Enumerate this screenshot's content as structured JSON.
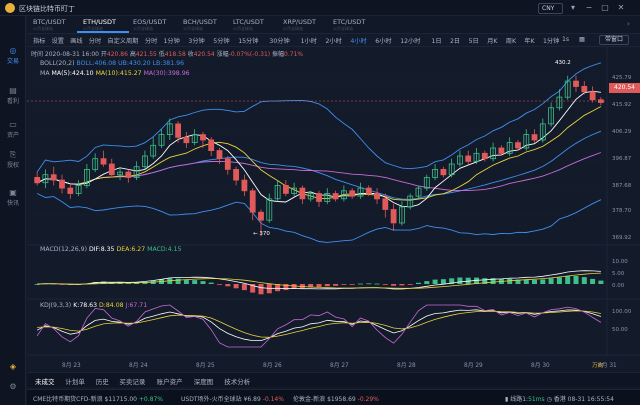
{
  "app": {
    "title": "区块链比特币盯丁",
    "currency": "CNY"
  },
  "sidebar": [
    {
      "label": "交易",
      "icon": "trade-icon",
      "active": true
    },
    {
      "label": "看利",
      "icon": "profit-icon"
    },
    {
      "label": "资产",
      "icon": "asset-icon"
    },
    {
      "label": "授权",
      "icon": "auth-icon"
    },
    {
      "label": "快讯",
      "icon": "news-icon"
    }
  ],
  "pairs": [
    {
      "name": "BTC/USDT",
      "sub": "火币全球站"
    },
    {
      "name": "ETH/USDT",
      "sub": "火币全球站",
      "active": true
    },
    {
      "name": "EOS/USDT",
      "sub": "火币全球站"
    },
    {
      "name": "BCH/USDT",
      "sub": "火币全球站"
    },
    {
      "name": "LTC/USDT",
      "sub": "火币全球站"
    },
    {
      "name": "XRP/USDT",
      "sub": "火币全球站"
    },
    {
      "name": "ETC/USDT",
      "sub": "火币全球站"
    }
  ],
  "toolbar": {
    "items": [
      "指标",
      "设置",
      "画线",
      "分时",
      "自定义周期",
      "分时",
      "1分钟",
      "3分钟",
      "5分钟",
      "15分钟",
      "30分钟",
      "1小时",
      "2小时",
      "4小时",
      "6小时",
      "12小时",
      "1日",
      "2日",
      "5日",
      "月K",
      "周K",
      "年K",
      "1分钟"
    ],
    "active": "4小时",
    "interval": "1s",
    "draw": "带窗口"
  },
  "info": {
    "time": "时间 2020-08-31 16:00",
    "open_l": "开",
    "open": "420.86",
    "high_l": "高",
    "high": "421.55",
    "low_l": "低",
    "low": "418.58",
    "close_l": "收",
    "close": "420.54",
    "chg_l": "涨幅",
    "chg": "-0.07%(-0.31)",
    "amp_l": "振幅",
    "amp": "0.71%"
  },
  "indicators": {
    "boll_label": "BOLL(20,2)",
    "boll": "BOLL:406.08",
    "ub": "UB:430.20",
    "lb": "LB:381.96",
    "ma_label": "MA",
    "ma5": "MA(5):424.10",
    "ma10": "MA(10):415.27",
    "ma30": "MA(30):398.96",
    "macd_label": "MACD(12,26,9)",
    "dif": "DIF:8.35",
    "dea": "DEA:6.27",
    "macd": "MACD:4.15",
    "kdj_label": "KDJ(9,3,3)",
    "k": "K:78.63",
    "d": "D:84.08",
    "j": "J:67.71"
  },
  "annotations": {
    "high": "430.2",
    "low": "370"
  },
  "y_ticks": [
    "425.79",
    "415.92",
    "406.29",
    "396.87",
    "387.68",
    "378.70",
    "369.92"
  ],
  "macd_ticks": [
    "10.00",
    "5.00",
    "0.00"
  ],
  "kdj_ticks": [
    "100.00",
    "50.00"
  ],
  "current_price": "420.54",
  "x_ticks": [
    "8月 23",
    "8月 24",
    "8月 25",
    "8月 26",
    "8月 27",
    "8月 28",
    "8月 29",
    "8月 30",
    "8月 31"
  ],
  "x_extra": "万向",
  "bottom_tabs": [
    "未成交",
    "计划单",
    "历史",
    "买卖记录",
    "账户资产",
    "深度图",
    "技术分析"
  ],
  "status": [
    {
      "label": "CME比特币期货CFD-新浪",
      "price": "$11715.00",
      "chg": "+0.87%",
      "dir": "up"
    },
    {
      "label": "USDT场外-火币全球站",
      "price": "¥6.89",
      "chg": "-0.14%",
      "dir": "down"
    },
    {
      "label": "伦敦金-新浪",
      "price": "$1958.69",
      "chg": "-0.29%",
      "dir": "down"
    }
  ],
  "status_right": {
    "line": "线路1:",
    "ms": "51ms",
    "tz": "香港 08-31 16:55:54"
  },
  "chart_data": {
    "type": "candlestick",
    "x": [
      "8月 23",
      "8月 24",
      "8月 25",
      "8月 26",
      "8月 27",
      "8月 28",
      "8月 29",
      "8月 30",
      "8月 31"
    ],
    "candles": [
      [
        392,
        390,
        394,
        389
      ],
      [
        390,
        393,
        395,
        388
      ],
      [
        393,
        391,
        396,
        389
      ],
      [
        391,
        388,
        393,
        386
      ],
      [
        388,
        386,
        390,
        384
      ],
      [
        386,
        389,
        391,
        385
      ],
      [
        389,
        395,
        397,
        388
      ],
      [
        395,
        399,
        401,
        394
      ],
      [
        399,
        397,
        402,
        396
      ],
      [
        397,
        393,
        399,
        392
      ],
      [
        393,
        394,
        396,
        391
      ],
      [
        394,
        392,
        395,
        390
      ],
      [
        392,
        396,
        398,
        391
      ],
      [
        396,
        400,
        402,
        395
      ],
      [
        400,
        404,
        407,
        399
      ],
      [
        404,
        408,
        410,
        403
      ],
      [
        408,
        412,
        414,
        406
      ],
      [
        412,
        407,
        413,
        405
      ],
      [
        407,
        405,
        409,
        403
      ],
      [
        405,
        408,
        410,
        404
      ],
      [
        408,
        406,
        409,
        403
      ],
      [
        406,
        402,
        407,
        400
      ],
      [
        402,
        399,
        403,
        397
      ],
      [
        399,
        395,
        400,
        393
      ],
      [
        395,
        391,
        396,
        389
      ],
      [
        391,
        387,
        393,
        385
      ],
      [
        387,
        379,
        388,
        376
      ],
      [
        379,
        376,
        380,
        370
      ],
      [
        376,
        384,
        386,
        375
      ],
      [
        384,
        389,
        391,
        383
      ],
      [
        389,
        386,
        391,
        385
      ],
      [
        386,
        388,
        390,
        385
      ],
      [
        388,
        384,
        389,
        382
      ],
      [
        384,
        386,
        387,
        383
      ],
      [
        386,
        383,
        387,
        381
      ],
      [
        383,
        386,
        388,
        382
      ],
      [
        386,
        384,
        387,
        383
      ],
      [
        384,
        387,
        389,
        383
      ],
      [
        387,
        385,
        388,
        384
      ],
      [
        385,
        388,
        390,
        384
      ],
      [
        388,
        386,
        389,
        385
      ],
      [
        386,
        384,
        388,
        382
      ],
      [
        384,
        380,
        386,
        377
      ],
      [
        380,
        375,
        382,
        372
      ],
      [
        375,
        381,
        383,
        374
      ],
      [
        381,
        385,
        386,
        380
      ],
      [
        385,
        388,
        389,
        384
      ],
      [
        388,
        392,
        393,
        387
      ],
      [
        392,
        395,
        397,
        391
      ],
      [
        395,
        393,
        396,
        392
      ],
      [
        393,
        397,
        399,
        392
      ],
      [
        397,
        400,
        402,
        396
      ],
      [
        400,
        398,
        402,
        397
      ],
      [
        398,
        401,
        403,
        397
      ],
      [
        401,
        399,
        402,
        398
      ],
      [
        399,
        403,
        405,
        398
      ],
      [
        403,
        401,
        404,
        400
      ],
      [
        401,
        405,
        407,
        400
      ],
      [
        405,
        403,
        406,
        402
      ],
      [
        403,
        408,
        410,
        402
      ],
      [
        408,
        406,
        410,
        405
      ],
      [
        406,
        412,
        414,
        405
      ],
      [
        412,
        418,
        420,
        411
      ],
      [
        418,
        422,
        425,
        417
      ],
      [
        422,
        428,
        430,
        421
      ],
      [
        428,
        426,
        430,
        424
      ],
      [
        426,
        424,
        428,
        423
      ],
      [
        424,
        421,
        426,
        420
      ],
      [
        421,
        420,
        422,
        419
      ]
    ]
  }
}
